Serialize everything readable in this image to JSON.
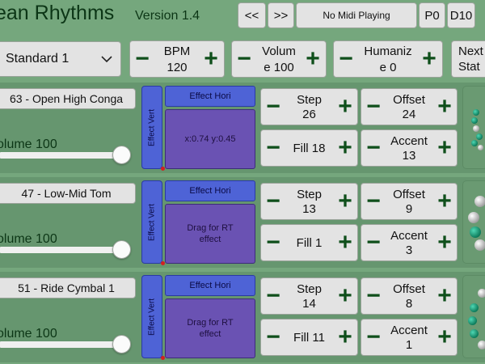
{
  "header": {
    "title": "ean Rhythms",
    "version": "Version 1.4",
    "prev_label": "<<",
    "next_label": ">>",
    "midi_status": "No Midi Playing",
    "p_label": "P0",
    "d_label": "D10"
  },
  "controls": {
    "preset": "Standard 1",
    "bpm_label": "BPM",
    "bpm_value": "120",
    "volume_label": "Volum",
    "volume_value": "e 100",
    "humanize_label": "Humaniz",
    "humanize_value": "e 0",
    "next_label": "Next",
    "next_sub": "Stat"
  },
  "tracks": [
    {
      "instrument": "63 - Open High Conga",
      "volume": "olume 100",
      "volume_fraction": 0.97,
      "effect_vert": "Effect Vert",
      "effect_hori": "Effect Hori",
      "pad_text": "x:0.74 y:0.45",
      "step_label": "Step",
      "step_value": "26",
      "offset_label": "Offset",
      "offset_value": "24",
      "fill_text": "Fill 18",
      "accent_label": "Accent",
      "accent_value": "13"
    },
    {
      "instrument": "47 - Low-Mid Tom",
      "volume": "olume 100",
      "volume_fraction": 0.97,
      "effect_vert": "Effect Vert",
      "effect_hori": "Effect Hori",
      "pad_text": "Drag for RT effect",
      "step_label": "Step",
      "step_value": "13",
      "offset_label": "Offset",
      "offset_value": "9",
      "fill_text": "Fill 1",
      "accent_label": "Accent",
      "accent_value": "3"
    },
    {
      "instrument": "51 - Ride Cymbal 1",
      "volume": "olume 100",
      "volume_fraction": 0.97,
      "effect_vert": "Effect Vert",
      "effect_hori": "Effect Hori",
      "pad_text": "Drag for RT effect",
      "step_label": "Step",
      "step_value": "14",
      "offset_label": "Offset",
      "offset_value": "8",
      "fill_text": "Fill 11",
      "accent_label": "Accent",
      "accent_value": "1"
    }
  ],
  "colors": {
    "background": "#75a77d",
    "effect_blue": "#4e63d6",
    "pad_purple": "#6a52b3",
    "plusminus_green": "#0f4f1b",
    "step_on": "#0d7a5a",
    "step_off": "#e8e8e8"
  },
  "icons": {
    "minus": "minus-icon",
    "plus": "plus-icon",
    "dropdown": "chevron-down-icon"
  }
}
